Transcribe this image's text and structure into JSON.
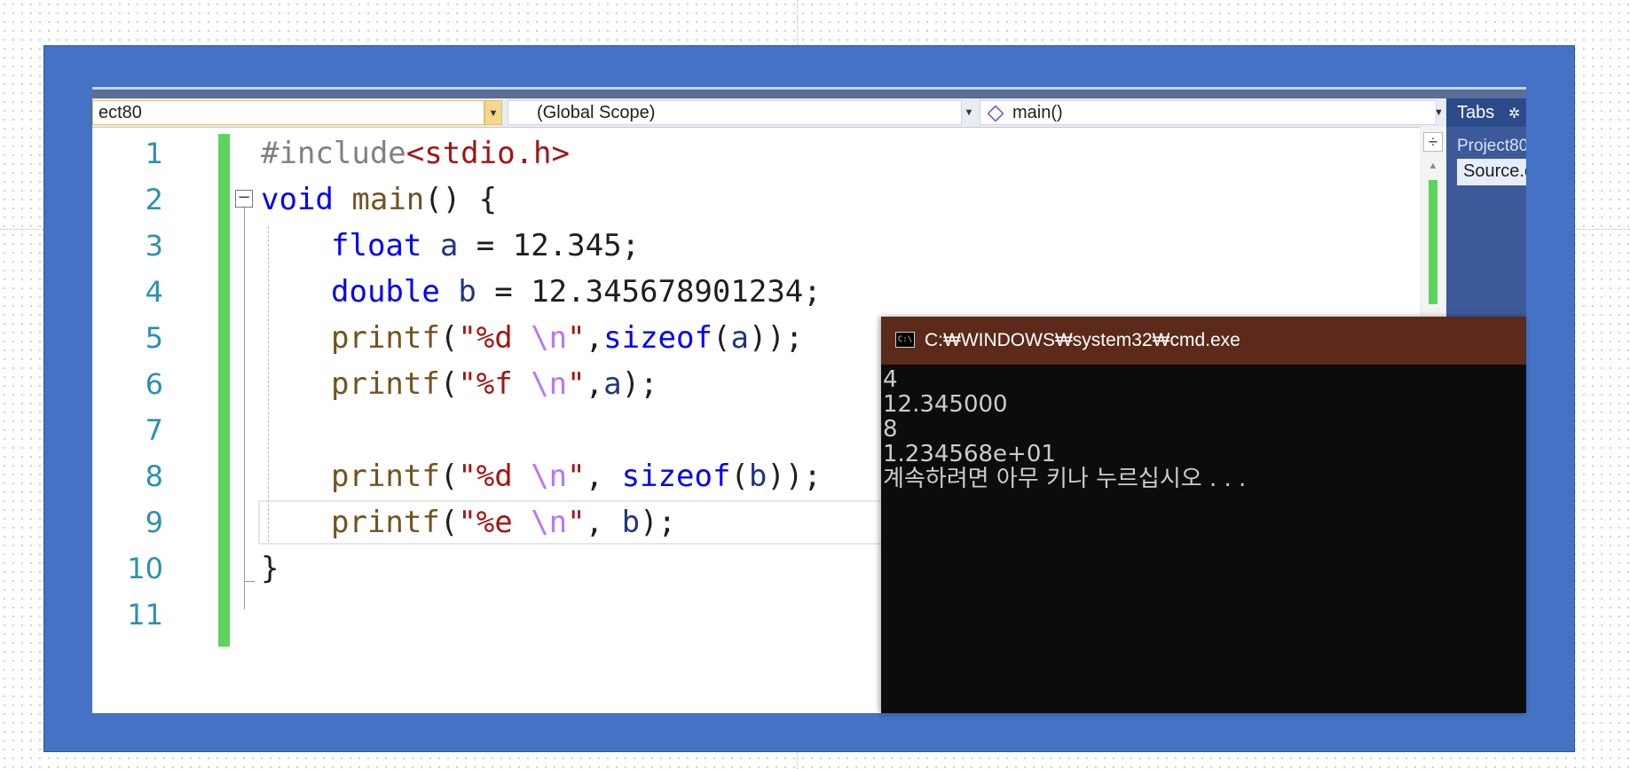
{
  "navbar": {
    "project_combo": "ect80",
    "scope_combo": "(Global Scope)",
    "member_combo": "main()"
  },
  "tabs_panel": {
    "title": "Tabs",
    "gear_glyph": "✲",
    "project": "Project80",
    "file": "Source.cpp"
  },
  "editor": {
    "line_numbers": [
      "1",
      "2",
      "3",
      "4",
      "5",
      "6",
      "7",
      "8",
      "9",
      "10",
      "11"
    ],
    "lines": [
      {
        "t": [
          [
            "pp",
            "#include"
          ],
          [
            "inc",
            "<stdio.h>"
          ]
        ]
      },
      {
        "t": [
          [
            "kw",
            "void"
          ],
          [
            "",
            " "
          ],
          [
            "fn",
            "main"
          ],
          [
            "",
            "() {"
          ]
        ]
      },
      {
        "t": [
          [
            "kw",
            "float"
          ],
          [
            "",
            " "
          ],
          [
            "var",
            "a"
          ],
          [
            "",
            " = 12.345;"
          ]
        ]
      },
      {
        "t": [
          [
            "kw",
            "double"
          ],
          [
            "",
            " "
          ],
          [
            "var",
            "b"
          ],
          [
            "",
            " = 12.345678901234;"
          ]
        ]
      },
      {
        "t": [
          [
            "fn",
            "printf"
          ],
          [
            "",
            "("
          ],
          [
            "str",
            "\"%d "
          ],
          [
            "esc",
            "\\n"
          ],
          [
            "str",
            "\""
          ],
          [
            "",
            ","
          ],
          [
            "kw",
            "sizeof"
          ],
          [
            "",
            "("
          ],
          [
            "var",
            "a"
          ],
          [
            "",
            "));"
          ]
        ]
      },
      {
        "t": [
          [
            "fn",
            "printf"
          ],
          [
            "",
            "("
          ],
          [
            "str",
            "\"%f "
          ],
          [
            "esc",
            "\\n"
          ],
          [
            "str",
            "\""
          ],
          [
            "",
            ","
          ],
          [
            "var",
            "a"
          ],
          [
            "",
            ");"
          ]
        ]
      },
      {
        "t": []
      },
      {
        "t": [
          [
            "fn",
            "printf"
          ],
          [
            "",
            "("
          ],
          [
            "str",
            "\"%d "
          ],
          [
            "esc",
            "\\n"
          ],
          [
            "str",
            "\""
          ],
          [
            "",
            ", "
          ],
          [
            "kw",
            "sizeof"
          ],
          [
            "",
            "("
          ],
          [
            "var",
            "b"
          ],
          [
            "",
            "));"
          ]
        ]
      },
      {
        "t": [
          [
            "fn",
            "printf"
          ],
          [
            "",
            "("
          ],
          [
            "str",
            "\"%e "
          ],
          [
            "esc",
            "\\n"
          ],
          [
            "str",
            "\""
          ],
          [
            "",
            ", "
          ],
          [
            "var",
            "b"
          ],
          [
            "",
            ");"
          ]
        ]
      },
      {
        "t": [
          [
            "",
            "}"
          ]
        ]
      },
      {
        "t": []
      }
    ],
    "collapse_glyph": "−"
  },
  "console": {
    "title": "C:₩WINDOWS₩system32₩cmd.exe",
    "icon_text": "C:\\",
    "output": [
      "4",
      "12.345000",
      "8",
      "1.234568e+01",
      "계속하려면 아무 키나 누르십시오 . . ."
    ]
  },
  "colors": {
    "frame": "#4472c4",
    "console_title": "#5c2a1b",
    "console_bg": "#0c0c0c",
    "change_bar": "#5ed35e",
    "keyword": "#0000ff",
    "string": "#a31515",
    "function": "#74531f",
    "escape": "#b776fb",
    "line_number": "#2b91af"
  }
}
